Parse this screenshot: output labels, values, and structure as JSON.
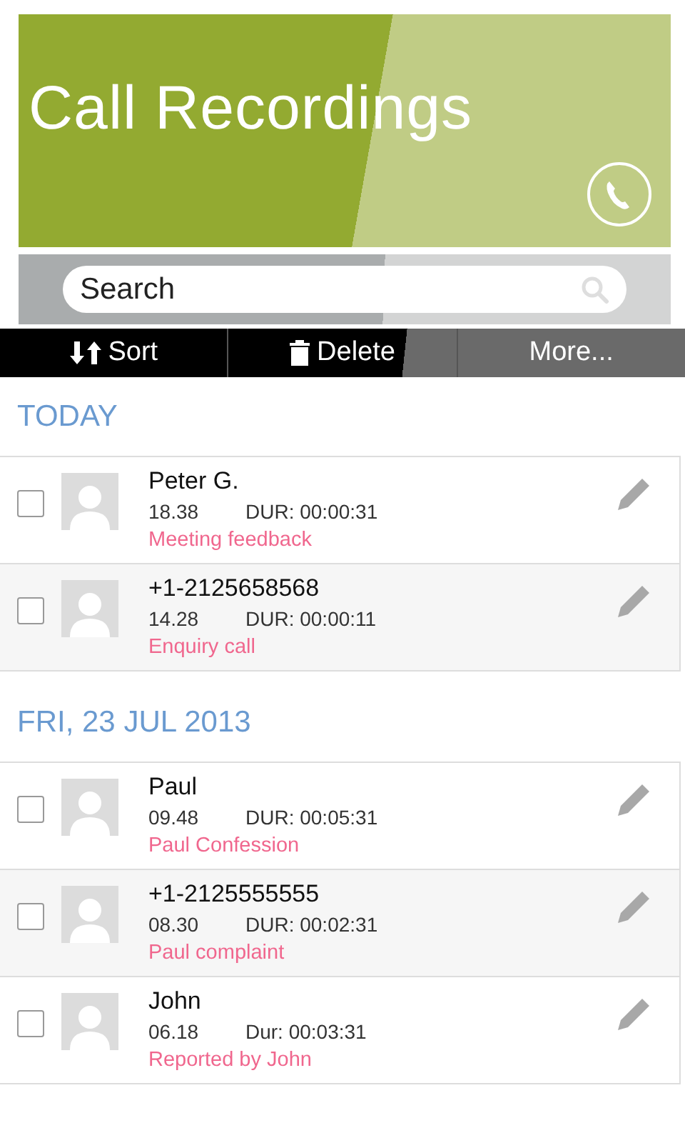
{
  "header": {
    "title": "Call Recordings"
  },
  "search": {
    "placeholder": "Search"
  },
  "toolbar": [
    {
      "label": "Sort",
      "kind": "sort"
    },
    {
      "label": "Delete",
      "kind": "delete"
    },
    {
      "label": "More...",
      "kind": "more"
    }
  ],
  "sections": [
    {
      "heading": "TODAY",
      "rows": [
        {
          "name": "Peter G.",
          "time": "18.38",
          "duration": "DUR: 00:00:31",
          "note": "Meeting feedback",
          "checked": false
        },
        {
          "name": "+1-2125658568",
          "time": "14.28",
          "duration": "DUR: 00:00:11",
          "note": "Enquiry call",
          "checked": false
        }
      ]
    },
    {
      "heading": "FRI, 23 JUL 2013",
      "rows": [
        {
          "name": "Paul",
          "time": "09.48",
          "duration": "DUR: 00:05:31",
          "note": "Paul Confession",
          "checked": false
        },
        {
          "name": "+1-2125555555",
          "time": "08.30",
          "duration": "DUR: 00:02:31",
          "note": "Paul complaint",
          "checked": false
        },
        {
          "name": "John",
          "time": "06.18",
          "duration": "Dur: 00:03:31",
          "note": "Reported by John",
          "checked": false
        }
      ]
    }
  ]
}
